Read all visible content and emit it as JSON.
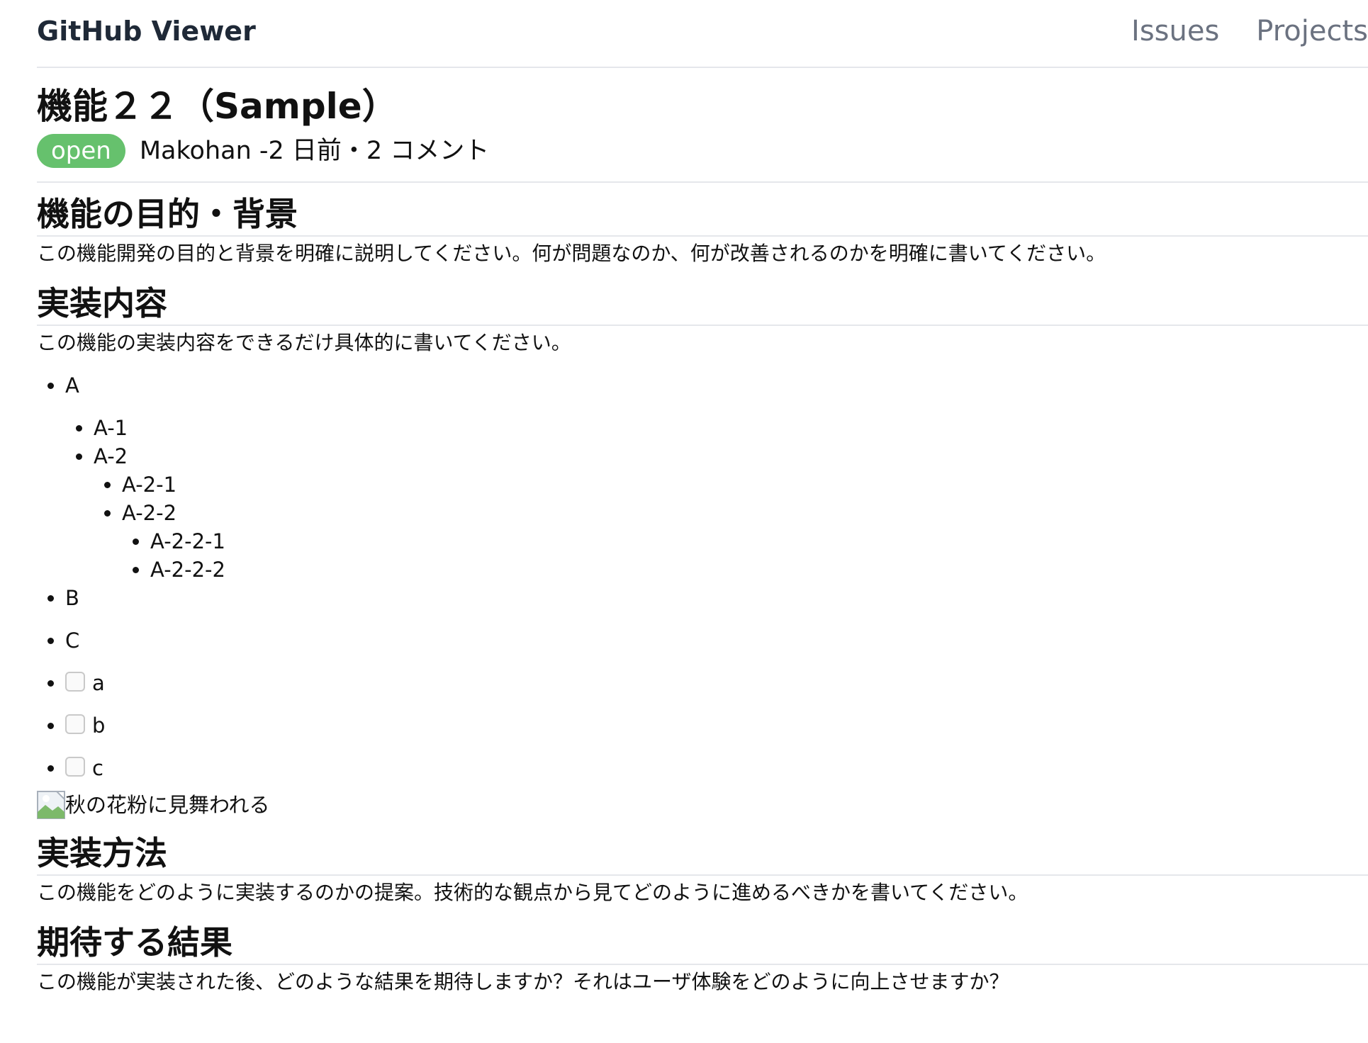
{
  "header": {
    "brand": "GitHub Viewer",
    "nav": [
      "Issues",
      "Projects"
    ]
  },
  "issue": {
    "title": "機能２２（Sample）",
    "status": "open",
    "meta": "Makohan -2 日前・2 コメント"
  },
  "body": {
    "purpose": {
      "heading": "機能の目的・背景",
      "text": "この機能開発の目的と背景を明確に説明してください。何が問題なのか、何が改善されるのかを明確に書いてください。"
    },
    "implementation": {
      "heading": "実装内容",
      "text": "この機能の実装内容をできるだけ具体的に書いてください。",
      "list": {
        "a": "A",
        "a1": "A-1",
        "a2": "A-2",
        "a21": "A-2-1",
        "a22": "A-2-2",
        "a221": "A-2-2-1",
        "a222": "A-2-2-2",
        "b": "B",
        "c": "C"
      },
      "tasks": [
        "a",
        "b",
        "c"
      ],
      "image_alt": "秋の花粉に見舞われる"
    },
    "method": {
      "heading": "実装方法",
      "text": "この機能をどのように実装するのかの提案。技術的な観点から見てどのように進めるべきかを書いてください。"
    },
    "expected": {
      "heading": "期待する結果",
      "text": "この機能が実装された後、どのような結果を期待しますか？それはユーザ体験をどのように向上させますか？"
    }
  },
  "colors": {
    "badge": "#66c16d",
    "nav": "#6b7280",
    "divider": "#e5e7eb"
  }
}
